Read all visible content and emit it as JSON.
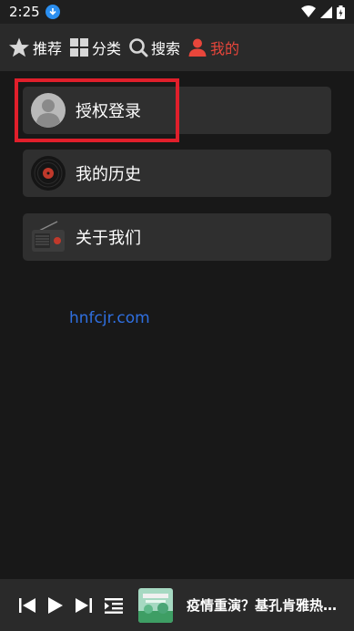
{
  "status_bar": {
    "time": "2:25"
  },
  "nav": {
    "tabs": [
      {
        "label": "推荐",
        "icon": "star-icon",
        "active": false
      },
      {
        "label": "分类",
        "icon": "grid-icon",
        "active": false
      },
      {
        "label": "搜索",
        "icon": "search-icon",
        "active": false
      },
      {
        "label": "我的",
        "icon": "person-icon",
        "active": true
      }
    ]
  },
  "menu": {
    "items": [
      {
        "label": "授权登录",
        "icon": "avatar-icon"
      },
      {
        "label": "我的历史",
        "icon": "vinyl-record-icon"
      },
      {
        "label": "关于我们",
        "icon": "radio-icon"
      }
    ]
  },
  "watermark": "hnfcjr.com",
  "player": {
    "track_title": "疫情重演？基孔肯雅热…",
    "controls": [
      "previous-icon",
      "play-icon",
      "next-icon",
      "playlist-icon"
    ]
  },
  "colors": {
    "accent": "#e8463b",
    "highlight": "#e01f2b",
    "watermark": "#2f6fe0",
    "background": "#181818",
    "bar": "#2a2a2a",
    "card": "#2f2f2f"
  }
}
